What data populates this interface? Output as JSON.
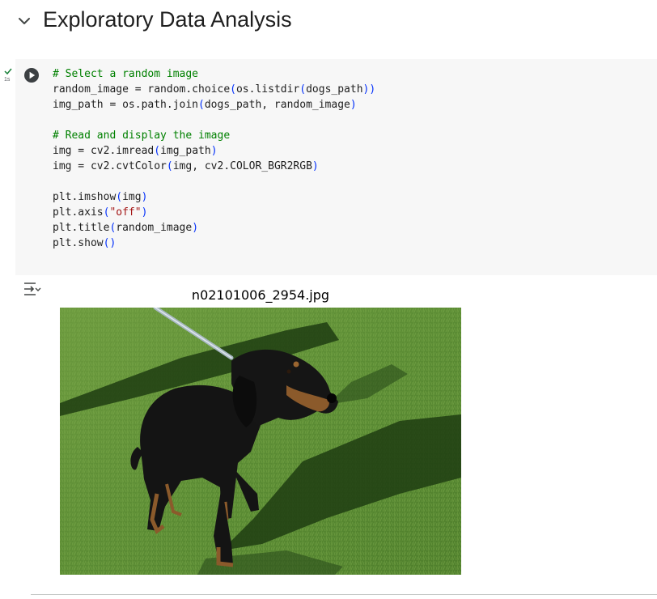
{
  "section": {
    "title": "Exploratory Data Analysis"
  },
  "execution": {
    "duration": "1s"
  },
  "code_lines": [
    [
      {
        "t": "# Select a random image",
        "c": "comment"
      }
    ],
    [
      {
        "t": "random_image = random.choice"
      },
      {
        "t": "(",
        "c": "paren"
      },
      {
        "t": "os.listdir"
      },
      {
        "t": "(",
        "c": "paren"
      },
      {
        "t": "dogs_path"
      },
      {
        "t": "))",
        "c": "paren"
      }
    ],
    [
      {
        "t": "img_path = os.path.join"
      },
      {
        "t": "(",
        "c": "paren"
      },
      {
        "t": "dogs_path, random_image"
      },
      {
        "t": ")",
        "c": "paren"
      }
    ],
    [],
    [
      {
        "t": "# Read and display the image",
        "c": "comment"
      }
    ],
    [
      {
        "t": "img = cv2.imread"
      },
      {
        "t": "(",
        "c": "paren"
      },
      {
        "t": "img_path"
      },
      {
        "t": ")",
        "c": "paren"
      }
    ],
    [
      {
        "t": "img = cv2.cvtColor"
      },
      {
        "t": "(",
        "c": "paren"
      },
      {
        "t": "img, cv2.COLOR_BGR2RGB"
      },
      {
        "t": ")",
        "c": "paren"
      }
    ],
    [],
    [
      {
        "t": "plt.imshow"
      },
      {
        "t": "(",
        "c": "paren"
      },
      {
        "t": "img"
      },
      {
        "t": ")",
        "c": "paren"
      }
    ],
    [
      {
        "t": "plt.axis"
      },
      {
        "t": "(",
        "c": "paren"
      },
      {
        "t": "\"off\"",
        "c": "string"
      },
      {
        "t": ")",
        "c": "paren"
      }
    ],
    [
      {
        "t": "plt.title"
      },
      {
        "t": "(",
        "c": "paren"
      },
      {
        "t": "random_image"
      },
      {
        "t": ")",
        "c": "paren"
      }
    ],
    [
      {
        "t": "plt.show"
      },
      {
        "t": "()",
        "c": "paren"
      }
    ]
  ],
  "output": {
    "plot_title": "n02101006_2954.jpg"
  },
  "colors": {
    "comment": "#008000",
    "paren": "#0431fa",
    "string": "#a31515",
    "cell_background": "#f7f7f7",
    "success": "#188038"
  },
  "icons": {
    "collapse": "chevron-down-icon",
    "status": "checkmark-icon",
    "run": "play-circle-icon",
    "output": "output-settings-icon"
  }
}
